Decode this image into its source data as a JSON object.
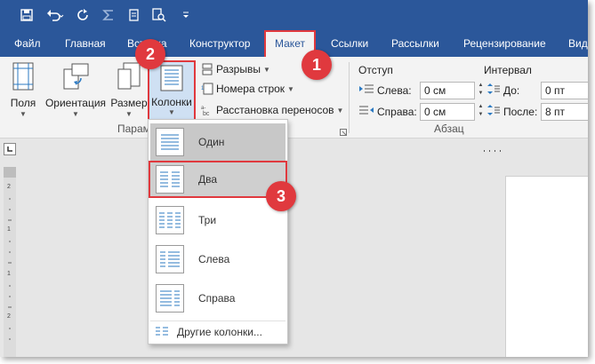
{
  "quick_access": {
    "icons": [
      "save-icon",
      "undo-icon",
      "redo-icon",
      "sum-icon",
      "print-preview-icon",
      "find-icon",
      "customize-icon"
    ]
  },
  "tabs": [
    "Файл",
    "Главная",
    "Вставка",
    "Конструктор",
    "Макет",
    "Ссылки",
    "Рассылки",
    "Рецензирование",
    "Вид"
  ],
  "active_tab": "Макет",
  "ribbon": {
    "page_setup": {
      "fields_label": "Поля",
      "orientation_label": "Ориентация",
      "size_label": "Размер",
      "columns_label": "Колонки",
      "group_label": "Парам",
      "breaks_label": "Разрывы",
      "line_numbers_label": "Номера строк",
      "hyphenation_label": "Расстановка переносов"
    },
    "indent": {
      "title": "Отступ",
      "left_label": "Слева:",
      "left_value": "0 см",
      "right_label": "Справа:",
      "right_value": "0 см"
    },
    "spacing": {
      "title": "Интервал",
      "before_label": "До:",
      "before_value": "0 пт",
      "after_label": "После:",
      "after_value": "8 пт"
    },
    "paragraph_group_label": "Абзац"
  },
  "columns_menu": {
    "items": [
      "Один",
      "Два",
      "Три",
      "Слева",
      "Справа"
    ],
    "selected": "Один",
    "highlighted": "Два",
    "more_label": "Другие колонки..."
  },
  "badges": [
    "1",
    "2",
    "3"
  ],
  "colors": {
    "accent": "#2b579a",
    "highlight": "#e0393e",
    "ribbon_bg": "#f3f3f3"
  }
}
